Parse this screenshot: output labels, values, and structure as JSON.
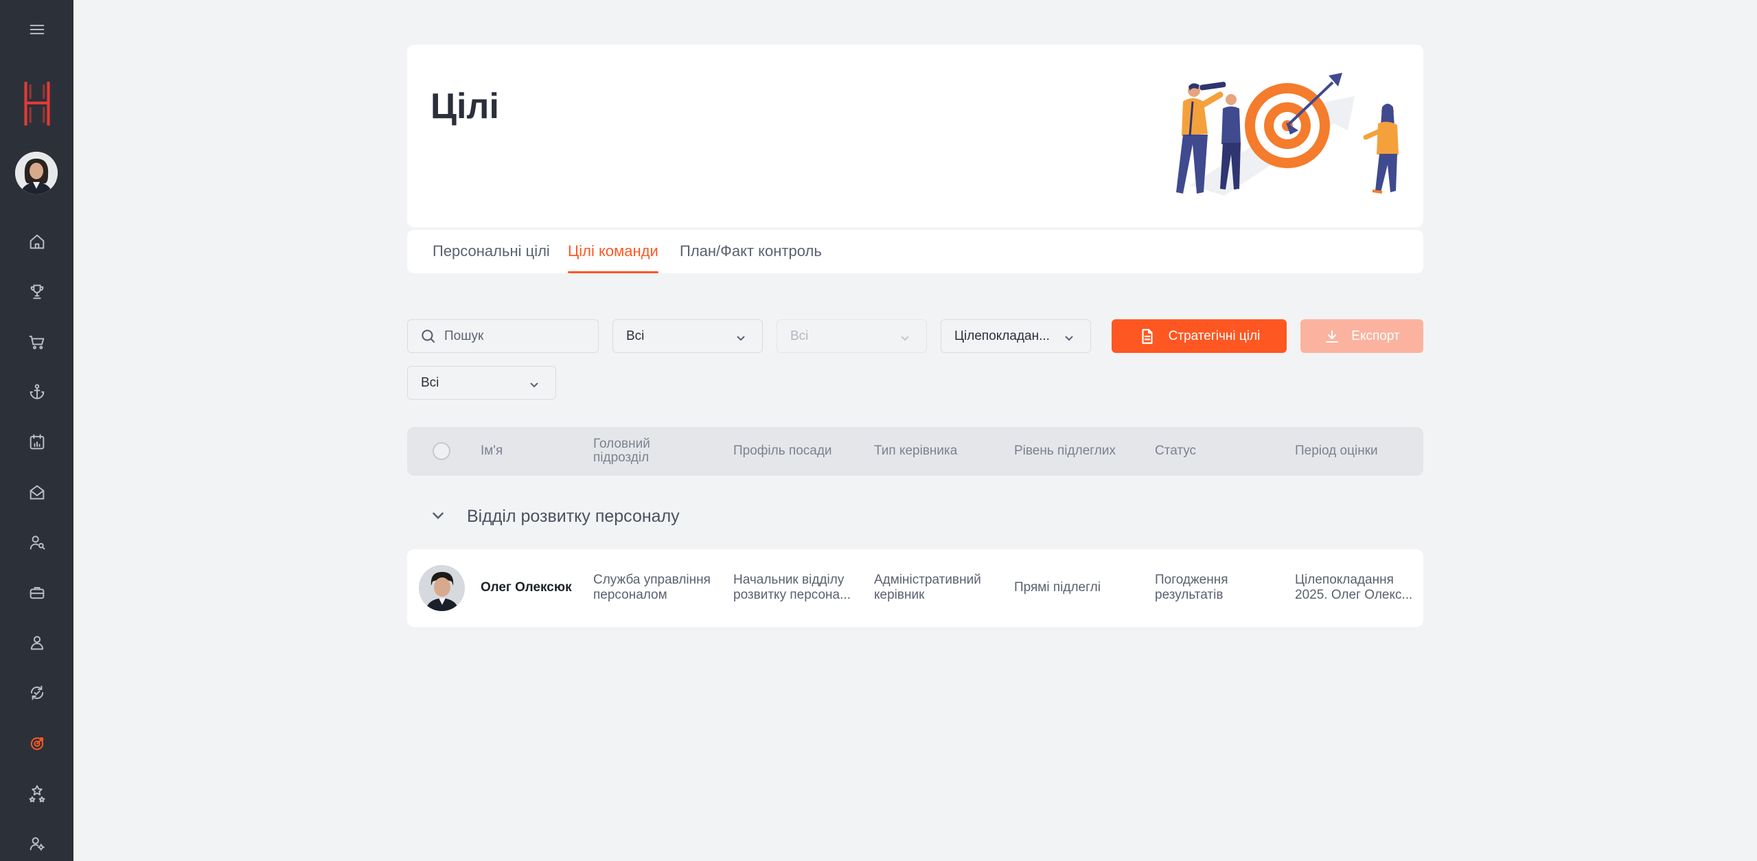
{
  "page": {
    "title": "Цілі"
  },
  "sidebar": {
    "items": [
      {
        "icon": "menu-icon"
      },
      {
        "icon": "brand-logo-icon"
      },
      {
        "icon": "user-avatar"
      },
      {
        "icon": "home-icon"
      },
      {
        "icon": "trophy-icon"
      },
      {
        "icon": "cart-icon"
      },
      {
        "icon": "anchor-icon"
      },
      {
        "icon": "calendar-chart-icon"
      },
      {
        "icon": "mail-open-icon"
      },
      {
        "icon": "user-search-icon"
      },
      {
        "icon": "briefcase-icon"
      },
      {
        "icon": "person-icon"
      },
      {
        "icon": "refresh-check-icon"
      },
      {
        "icon": "target-icon",
        "active": true
      },
      {
        "icon": "stars-icon"
      },
      {
        "icon": "user-settings-icon"
      }
    ]
  },
  "tabs": [
    {
      "label": "Персональні цілі",
      "active": false
    },
    {
      "label": "Цілі команди",
      "active": true
    },
    {
      "label": "План/Факт контроль",
      "active": false
    }
  ],
  "filters": {
    "search_placeholder": "Пошук",
    "select1": "Всі",
    "select2": "Всі",
    "select3": "Цілепокладан...",
    "select4": "Всі",
    "strategic_button": "Стратегічні цілі",
    "export_button": "Експорт"
  },
  "table": {
    "columns": [
      "Ім'я",
      "Головний підрозділ",
      "Профіль посади",
      "Тип керівника",
      "Рівень підлеглих",
      "Статус",
      "Період оцінки"
    ],
    "group": "Відділ розвитку персоналу",
    "rows": [
      {
        "name": "Олег Олексюк",
        "department": "Служба управління персоналом",
        "position": "Начальник відділу розвитку персона...",
        "manager_type": "Адміністративний керівник",
        "subordinates": "Прямі підлеглі",
        "status": "Погодження результатів",
        "period": "Цілепокладання 2025. Олег Олекс..."
      }
    ]
  },
  "colors": {
    "accent": "#ff5722",
    "sidebar": "#2c3139",
    "background": "#f2f3f5"
  }
}
